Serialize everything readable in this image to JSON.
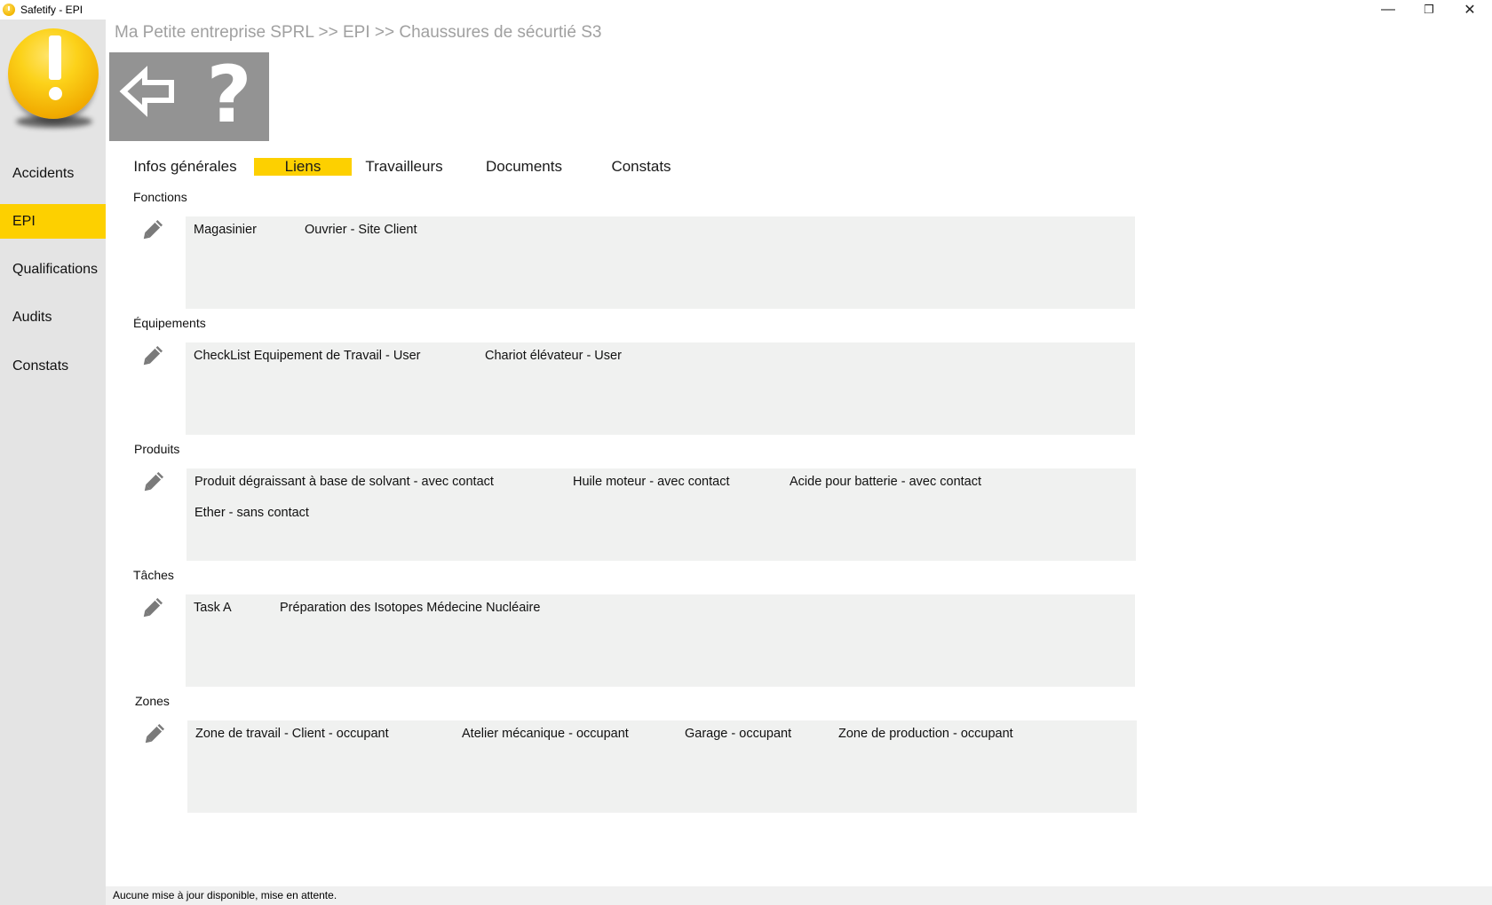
{
  "window": {
    "title": "Safetify - EPI",
    "controls": {
      "minimize": "—",
      "maximize": "❐",
      "close": "✕"
    }
  },
  "sidebar": {
    "items": [
      {
        "label": "Accidents",
        "active": false
      },
      {
        "label": "EPI",
        "active": true
      },
      {
        "label": "Qualifications",
        "active": false
      },
      {
        "label": "Audits",
        "active": false
      },
      {
        "label": "Constats",
        "active": false
      }
    ]
  },
  "breadcrumb": "Ma Petite entreprise SPRL >> EPI >> Chaussures de sécurtié S3",
  "toolbar": {
    "back_icon": "arrow-left-icon",
    "help_label": "?"
  },
  "tabs": [
    {
      "label": "Infos générales",
      "active": false
    },
    {
      "label": "Liens",
      "active": true
    },
    {
      "label": "Travailleurs",
      "active": false
    },
    {
      "label": "Documents",
      "active": false
    },
    {
      "label": "Constats",
      "active": false
    }
  ],
  "sections": [
    {
      "label": "Fonctions",
      "items": [
        "Magasinier",
        "Ouvrier - Site Client"
      ]
    },
    {
      "label": "Équipements",
      "items": [
        "CheckList Equipement de Travail  - User",
        "Chariot élévateur - User"
      ]
    },
    {
      "label": "Produits",
      "items": [
        "Produit dégraissant à base de solvant  - avec contact",
        "Huile moteur - avec contact",
        "Acide pour batterie - avec contact",
        "Ether - sans contact"
      ]
    },
    {
      "label": "Tâches",
      "items": [
        "Task A",
        "Préparation des Isotopes Médecine Nucléaire"
      ]
    },
    {
      "label": "Zones",
      "items": [
        "Zone de travail - Client - occupant",
        "Atelier mécanique - occupant",
        "Garage - occupant",
        "Zone de production - occupant"
      ]
    }
  ],
  "status": "Aucune mise à jour disponible, mise en attente.",
  "colors": {
    "accent": "#fdd000",
    "sidebar": "#e4e4e4",
    "toolbar": "#939393",
    "box": "#f0f1f0"
  }
}
